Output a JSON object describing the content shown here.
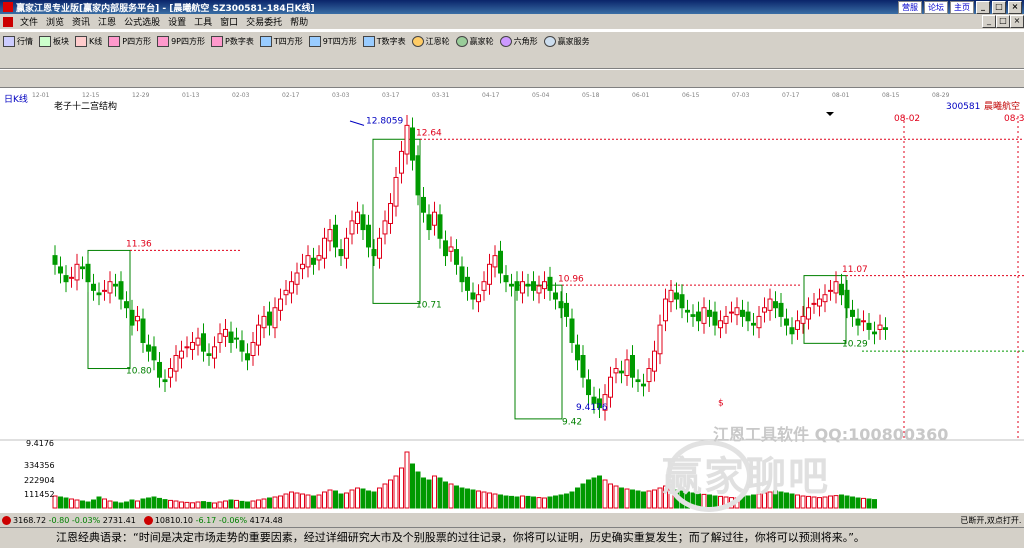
{
  "window": {
    "title": "赢家江恩专业版[赢家内部服务平台] - [晨曦航空  SZ300581-184日K线]",
    "links": [
      "营服",
      "论坛",
      "主页"
    ],
    "buttons": [
      "_",
      "□",
      "×"
    ]
  },
  "menu": {
    "items": [
      "文件",
      "浏览",
      "资讯",
      "江恩",
      "公式选股",
      "设置",
      "工具",
      "窗口",
      "交易委托",
      "帮助"
    ],
    "right_buttons": [
      "_",
      "□",
      "×"
    ]
  },
  "toolbar": {
    "items": [
      "行情",
      "板块",
      "K线",
      "P四方形",
      "9P四方形",
      "P数字表",
      "T四方形",
      "9T四方形",
      "T数字表",
      "江恩轮",
      "赢家轮",
      "六角形",
      "赢家服务"
    ]
  },
  "chart": {
    "period_label": "日K线",
    "indicator_title": "老子十二宫结构",
    "stock_code": "300581",
    "stock_name": "晨曦航空",
    "date_ticks": [
      "12-01",
      "12-15",
      "12-29",
      "01-13",
      "02-03",
      "02-17",
      "03-03",
      "03-17",
      "03-31",
      "04-17",
      "05-04",
      "05-18",
      "06-01",
      "06-15",
      "07-03",
      "07-17",
      "08-01",
      "08-15",
      "08-29"
    ],
    "future_marks": [
      "08-02",
      "08-3"
    ],
    "y_left_low": "9.4176",
    "volume_ticks": [
      "334356",
      "222904",
      "111452"
    ],
    "annotations": [
      "12.8059",
      "12.64",
      "11.36",
      "10.80",
      "10.71",
      "10.96",
      "9.42",
      "9.4176",
      "11.07",
      "10.29",
      "$"
    ]
  },
  "status": {
    "index1": "3168.72",
    "index1_change": "-0.80",
    "index1_pct": "-0.03%",
    "index1_amount": "2731.41",
    "index2": "10810.10",
    "index2_change": "-6.17",
    "index2_pct": "-0.06%",
    "index2_amount": "4174.48",
    "right_text": "已断开,双点打开."
  },
  "quote": "江恩经典语录：“时间是决定市场走势的重要因素，经过详细研究大市及个别股票的过往记录，你将可以证明，历史确实重复发生；而了解过往，你将可以预测将来。”。",
  "watermark": {
    "line1": "江恩工具软件  QQ:100800360",
    "line2": "赢家聊吧"
  },
  "colors": {
    "up": "#e0001a",
    "down": "#009900",
    "box": "#008000",
    "resistance": "#e0001a",
    "title_bar": "#0a246a"
  },
  "chart_data": {
    "type": "candlestick",
    "price_range": [
      9.2,
      13.0
    ],
    "closes": [
      11.2,
      11.1,
      11.0,
      11.05,
      11.2,
      11.15,
      11.0,
      10.9,
      10.85,
      10.9,
      11.0,
      10.95,
      10.8,
      10.7,
      10.5,
      10.6,
      10.3,
      10.2,
      10.1,
      9.9,
      9.85,
      10.0,
      10.15,
      10.2,
      10.25,
      10.3,
      10.35,
      10.2,
      10.15,
      10.25,
      10.4,
      10.45,
      10.3,
      10.35,
      10.2,
      10.1,
      10.3,
      10.5,
      10.6,
      10.5,
      10.7,
      10.8,
      10.9,
      11.0,
      11.1,
      11.2,
      11.3,
      11.2,
      11.3,
      11.5,
      11.6,
      11.4,
      11.3,
      11.5,
      11.7,
      11.8,
      11.6,
      11.4,
      11.3,
      11.5,
      11.7,
      11.9,
      12.2,
      12.5,
      12.8,
      12.4,
      12.0,
      11.8,
      11.6,
      11.8,
      11.5,
      11.3,
      11.4,
      11.2,
      11.0,
      10.9,
      10.8,
      10.85,
      11.0,
      11.2,
      11.3,
      11.1,
      11.0,
      10.95,
      10.9,
      11.0,
      10.95,
      10.9,
      10.95,
      11.0,
      10.9,
      10.8,
      10.7,
      10.6,
      10.3,
      10.1,
      9.9,
      9.7,
      9.6,
      9.55,
      9.7,
      9.9,
      10.0,
      9.95,
      10.1,
      9.9,
      9.85,
      9.8,
      10.0,
      10.2,
      10.5,
      10.8,
      10.9,
      10.8,
      10.7,
      10.65,
      10.6,
      10.55,
      10.7,
      10.6,
      10.5,
      10.55,
      10.6,
      10.65,
      10.7,
      10.6,
      10.55,
      10.5,
      10.6,
      10.7,
      10.8,
      10.7,
      10.6,
      10.5,
      10.4,
      10.55,
      10.6,
      10.7,
      10.75,
      10.8,
      10.85,
      10.9,
      11.0,
      10.85,
      10.7,
      10.6,
      10.5,
      10.55,
      10.45,
      10.4,
      10.5,
      10.45
    ],
    "volume": [
      60,
      55,
      50,
      45,
      40,
      35,
      30,
      40,
      55,
      45,
      35,
      30,
      25,
      30,
      40,
      35,
      45,
      50,
      55,
      48,
      42,
      38,
      35,
      30,
      28,
      26,
      30,
      32,
      28,
      25,
      30,
      35,
      40,
      38,
      33,
      30,
      35,
      40,
      45,
      50,
      55,
      60,
      70,
      80,
      75,
      70,
      65,
      60,
      65,
      80,
      90,
      85,
      70,
      75,
      90,
      100,
      95,
      85,
      80,
      100,
      120,
      140,
      160,
      200,
      280,
      220,
      180,
      150,
      140,
      160,
      150,
      130,
      120,
      110,
      100,
      95,
      90,
      85,
      80,
      75,
      70,
      65,
      60,
      58,
      55,
      60,
      58,
      55,
      52,
      50,
      55,
      60,
      65,
      70,
      80,
      100,
      120,
      140,
      150,
      160,
      140,
      120,
      110,
      100,
      95,
      90,
      85,
      80,
      85,
      90,
      100,
      110,
      95,
      90,
      85,
      80,
      75,
      70,
      68,
      65,
      60,
      58,
      55,
      52,
      50,
      55,
      60,
      65,
      70,
      75,
      80,
      85,
      80,
      75,
      70,
      65,
      60,
      58,
      55,
      52,
      55,
      60,
      62,
      65,
      60,
      55,
      50,
      48,
      45,
      42
    ]
  }
}
